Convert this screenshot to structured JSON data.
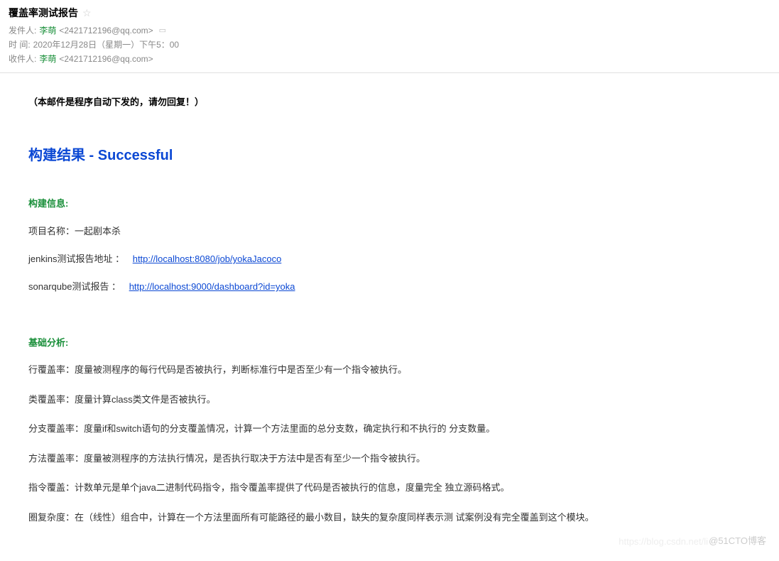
{
  "header": {
    "subject": "覆盖率测试报告",
    "from_label": "发件人:",
    "from_name": "李萌",
    "from_email": "<2421712196@qq.com>",
    "time_label": "时    间:",
    "time_value": "2020年12月28日（星期一）下午5：00",
    "to_label": "收件人:",
    "to_name": "李萌",
    "to_email": "<2421712196@qq.com>"
  },
  "body": {
    "notice": "（本邮件是程序自动下发的，请勿回复！）",
    "build_result": "构建结果 - Successful",
    "build_info_title": "构建信息:",
    "project_name_label": "项目名称：一起剧本杀",
    "jenkins_label": "jenkins测试报告地址 ：",
    "jenkins_url": "http://localhost:8080/job/yokaJacoco",
    "sonar_label": "sonarqube测试报告 ：",
    "sonar_url": "http://localhost:9000/dashboard?id=yoka",
    "analysis_title": "基础分析:",
    "analysis": [
      "行覆盖率：度量被测程序的每行代码是否被执行，判断标准行中是否至少有一个指令被执行。",
      "类覆盖率：度量计算class类文件是否被执行。",
      "分支覆盖率：度量if和switch语句的分支覆盖情况，计算一个方法里面的总分支数，确定执行和不执行的 分支数量。",
      "方法覆盖率：度量被测程序的方法执行情况，是否执行取决于方法中是否有至少一个指令被执行。",
      "指令覆盖：计数单元是单个java二进制代码指令，指令覆盖率提供了代码是否被执行的信息，度量完全 独立源码格式。",
      "圈复杂度：在（线性）组合中，计算在一个方法里面所有可能路径的最小数目，缺失的复杂度同样表示测 试案例没有完全覆盖到这个模块。"
    ]
  },
  "watermark": {
    "faded": "https://blog.csdn.net/li",
    "text": "@51CTO博客"
  }
}
